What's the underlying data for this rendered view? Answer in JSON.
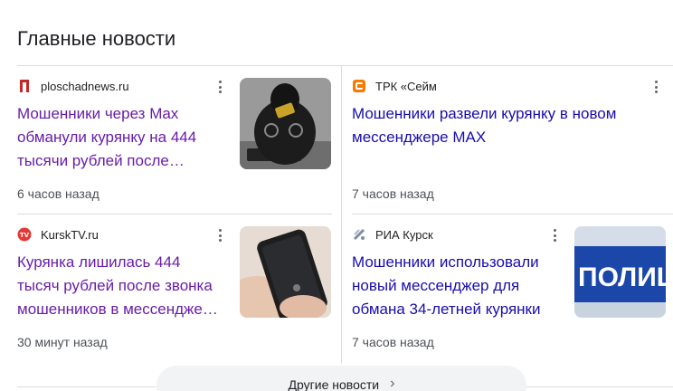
{
  "heading": "Главные новости",
  "more_news_label": "Другие новости",
  "cards": [
    {
      "source": "ploschadnews.ru",
      "title_lines": [
        "Мошенники через Max",
        "обманули курянку на 444",
        "тысячи рублей после…"
      ],
      "time": "6 часов назад",
      "favicon": "ploschadnews-logo-icon",
      "thumbnail": "hooded-man-with-card-image",
      "title_color": "#681da8"
    },
    {
      "source": "ТРК «Сейм",
      "title_lines": [
        "Мошенники развели курянку в новом",
        "мессенджере MAX"
      ],
      "time": "7 часов назад",
      "favicon": "seym-logo-icon",
      "title_color": "#1a0dab"
    },
    {
      "source": "KurskTV.ru",
      "title_lines": [
        "Курянка лишилась 444",
        "тысяч рублей после звонка",
        "мошенников в мессендже…"
      ],
      "time": "30 минут назад",
      "favicon": "kursktv-logo-icon",
      "thumbnail": "phone-in-hand-image",
      "title_color": "#681da8"
    },
    {
      "source": "РИА Курск",
      "title_lines": [
        "Мошенники использовали",
        "новый мессенджер для",
        "обмана 34-летней курянки"
      ],
      "time": "7 часов назад",
      "favicon": "ria-kursk-logo-icon",
      "thumbnail": "police-car-image",
      "thumbnail_text": "ПОЛИЦИ",
      "title_color": "#1a0dab"
    }
  ]
}
